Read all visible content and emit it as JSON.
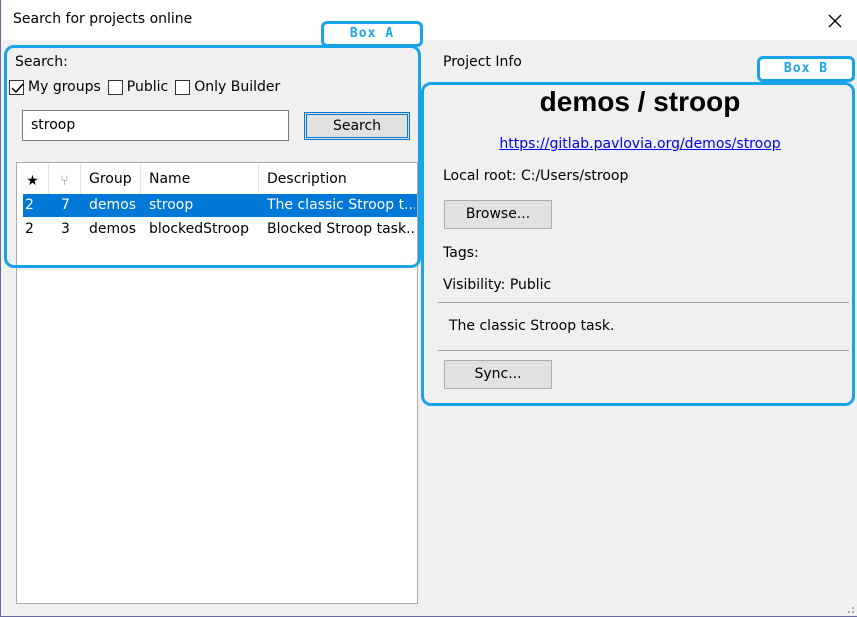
{
  "window": {
    "title": "Search for projects online"
  },
  "search": {
    "label": "Search:",
    "checkboxes": [
      {
        "label": "My groups",
        "checked": true
      },
      {
        "label": "Public",
        "checked": false
      },
      {
        "label": "Only Builder",
        "checked": false
      }
    ],
    "query": "stroop",
    "button_label": "Search"
  },
  "results": {
    "columns": [
      "★",
      "⑂",
      "Group",
      "Name",
      "Description"
    ],
    "rows": [
      {
        "stars": "2",
        "forks": "7",
        "group": "demos",
        "name": "stroop",
        "description": "The classic Stroop t...",
        "selected": true
      },
      {
        "stars": "2",
        "forks": "3",
        "group": "demos",
        "name": "blockedStroop",
        "description": "Blocked Stroop task...",
        "selected": false
      }
    ]
  },
  "project": {
    "section_label": "Project Info",
    "title": "demos / stroop",
    "url": "https://gitlab.pavlovia.org/demos/stroop",
    "local_root": "Local root: C:/Users/stroop",
    "browse_label": "Browse...",
    "tags": "Tags:",
    "visibility": "Visibility: Public",
    "description": "The classic Stroop task.",
    "sync_label": "Sync..."
  },
  "annotations": {
    "box_a": "Box A",
    "box_b": "Box B",
    "color": "#1aa3e8"
  }
}
